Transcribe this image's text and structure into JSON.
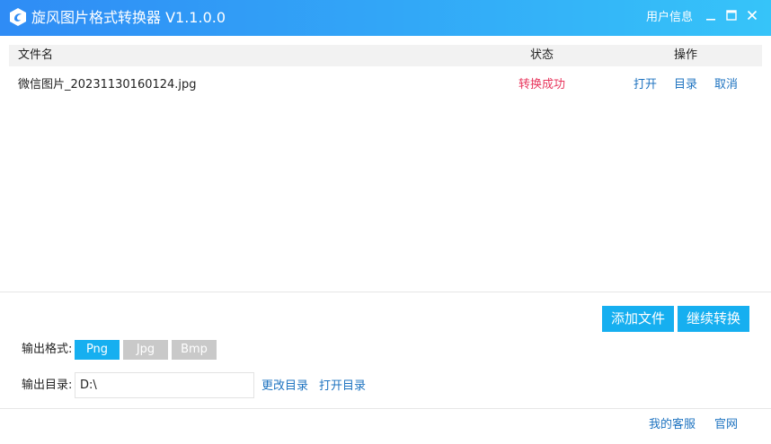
{
  "window": {
    "title": "旋风图片格式转换器 V1.1.0.0",
    "user_info": "用户信息",
    "logo_icon": "swirl-logo-icon",
    "controls": [
      "minimize-icon",
      "maximize-icon",
      "close-icon"
    ]
  },
  "table": {
    "columns": {
      "name": "文件名",
      "status": "状态",
      "ops": "操作"
    },
    "rows": [
      {
        "name": "微信图片_20231130160124.jpg",
        "status": "转换成功",
        "ops": {
          "open": "打开",
          "dir": "目录",
          "cancel": "取消"
        }
      }
    ]
  },
  "actions": {
    "add_file": "添加文件",
    "continue": "继续转换"
  },
  "output": {
    "format_label": "输出格式:",
    "formats": [
      {
        "label": "Png",
        "selected": true
      },
      {
        "label": "Jpg",
        "selected": false
      },
      {
        "label": "Bmp",
        "selected": false
      }
    ],
    "dir_label": "输出目录:",
    "dir_value": "D:\\",
    "change_dir": "更改目录",
    "open_dir": "打开目录"
  },
  "footer": {
    "service": "我的客服",
    "website": "官网"
  },
  "colors": {
    "accent": "#16aff0",
    "title_gradient_start": "#2f8cf5",
    "title_gradient_end": "#36c4f9",
    "success": "#e8365d",
    "link": "#1e73c0",
    "format_unselected": "#c9c9c9"
  }
}
